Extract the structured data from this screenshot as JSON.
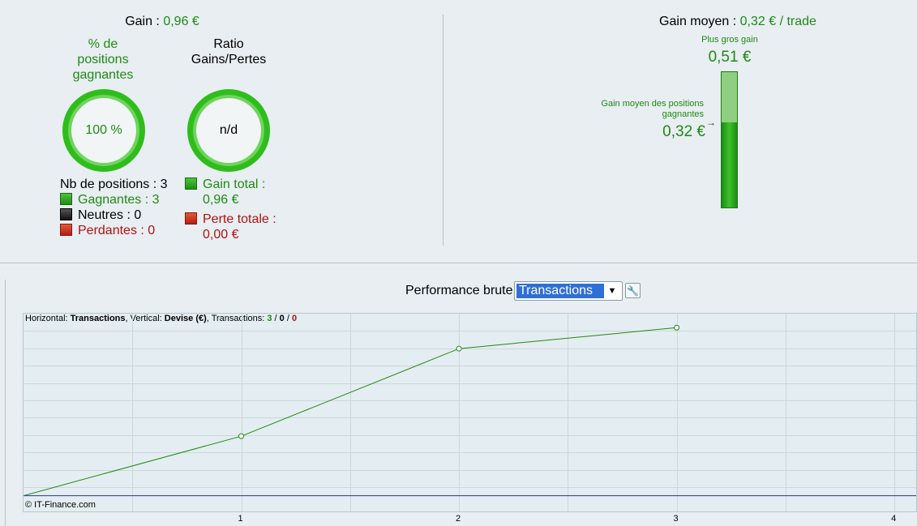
{
  "summary": {
    "gain_label": "Gain : ",
    "gain_value": "0,96 €",
    "pct_title": "% de positions gagnantes",
    "pct_value": "100 %",
    "ratio_title": "Ratio Gains/Pertes",
    "ratio_value": "n/d",
    "nb_positions": "Nb de positions : 3",
    "gagnantes": "Gagnantes : 3",
    "neutres": "Neutres : 0",
    "perdantes": "Perdantes : 0",
    "gain_total_label": "Gain total :",
    "gain_total_value": "0,96 €",
    "perte_totale_label": "Perte totale :",
    "perte_totale_value": "0,00 €"
  },
  "average": {
    "label": "Gain moyen : ",
    "value": "0,32 € / trade",
    "max_label": "Plus gros gain",
    "max_value": "0,51 €",
    "avg_win_label": "Gain moyen des positions gagnantes",
    "avg_win_value": "0,32 €",
    "bar_fill_fraction": 0.627
  },
  "performance": {
    "title": "Performance brute",
    "select_value": "Transactions",
    "tool_icon": "wrench-icon"
  },
  "chart_header": {
    "h_label": "Horizontal: ",
    "h_value": "Transactions",
    "v_label": ", Vertical: ",
    "v_value": "Devise (€)",
    "t_label": ", Transactions: ",
    "t_win": "3",
    "t_sep1": " / ",
    "t_neutral": "0",
    "t_sep2": " / ",
    "t_loss": "0"
  },
  "chart_data": {
    "type": "line",
    "x": [
      0,
      1,
      2,
      3
    ],
    "y": [
      0,
      0.34,
      0.84,
      0.96
    ],
    "xlim": [
      0,
      4.1
    ],
    "ylim": [
      -0.09,
      1.04
    ],
    "x_ticks": [
      "1",
      "2",
      "3",
      "4"
    ],
    "baseline": 0,
    "line_color": "#1f8a12",
    "baseline_color": "#2233bb",
    "grid": true
  },
  "copyright": "© IT-Finance.com"
}
